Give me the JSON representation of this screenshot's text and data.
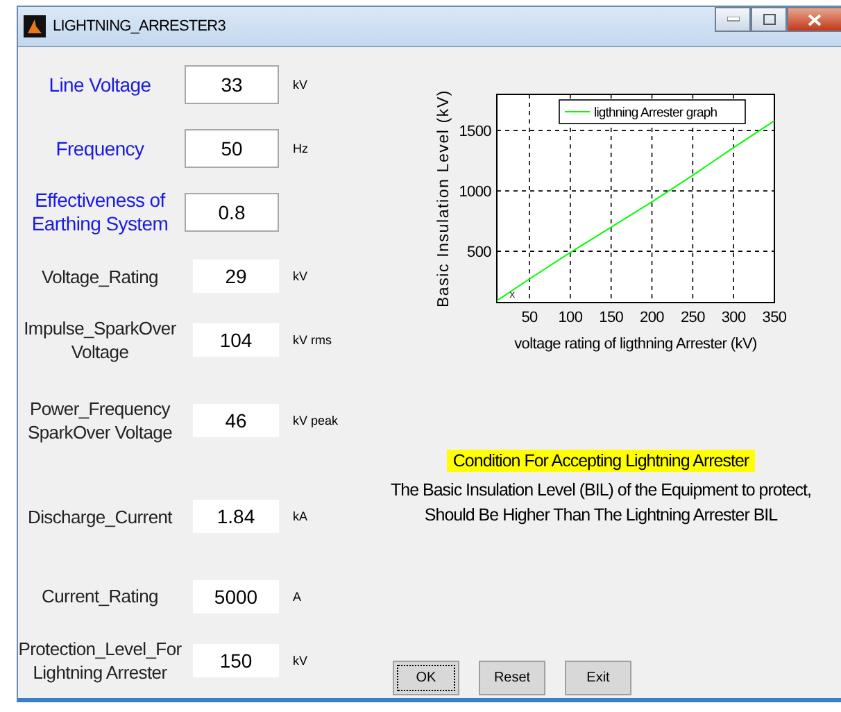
{
  "window": {
    "title": "LIGHTNING_ARRESTER3"
  },
  "fields": [
    {
      "label": "Line Voltage",
      "value": "33",
      "unit": "kV",
      "kind": "input"
    },
    {
      "label": "Frequency",
      "value": "50",
      "unit": "Hz",
      "kind": "input"
    },
    {
      "label": "Effectiveness of Earthing System",
      "value": "0.8",
      "kind": "input"
    },
    {
      "label": "Voltage_Rating",
      "value": "29",
      "unit": "kV",
      "kind": "output"
    },
    {
      "label": "Impulse_SparkOver Voltage",
      "value": "104",
      "unit": "kV rms",
      "kind": "output"
    },
    {
      "label": "Power_Frequency SparkOver Voltage",
      "value": "46",
      "unit": "kV peak",
      "kind": "output"
    },
    {
      "label": "Discharge_Current",
      "value": "1.84",
      "unit": "kA",
      "kind": "output"
    },
    {
      "label": "Current_Rating",
      "value": "5000",
      "unit": "A",
      "kind": "output"
    },
    {
      "label": "Protection_Level_For Lightning Arrester",
      "value": "150",
      "unit": "kV",
      "kind": "output"
    }
  ],
  "graph": {
    "chart_data": {
      "type": "line",
      "xlabel": "voltage rating of ligthning Arrester (kV)",
      "ylabel": "Basic Insulation Level (kV)",
      "x": [
        10,
        50,
        100,
        150,
        200,
        250,
        300,
        350
      ],
      "series": [
        {
          "name": "ligthning Arrester graph",
          "color": "#00ff00",
          "values": [
            90,
            270,
            490,
            700,
            910,
            1130,
            1360,
            1580
          ]
        }
      ],
      "xlim": [
        10,
        350
      ],
      "ylim": [
        75,
        1800
      ],
      "xticks": [
        50,
        100,
        150,
        200,
        250,
        300,
        350
      ],
      "yticks": [
        500,
        1000,
        1500
      ],
      "grid": true,
      "annotations": [
        {
          "x": 29,
          "y": 150,
          "text": "x"
        }
      ]
    }
  },
  "condition": {
    "heading": "Condition For Accepting Lightning Arrester",
    "text": "The Basic Insulation Level  (BIL) of the Equipment to protect, Should Be Higher Than The Lightning Arrester BIL"
  },
  "buttons": [
    {
      "label": "OK",
      "focused": true
    },
    {
      "label": "Reset",
      "focused": false
    },
    {
      "label": "Exit",
      "focused": false
    }
  ]
}
